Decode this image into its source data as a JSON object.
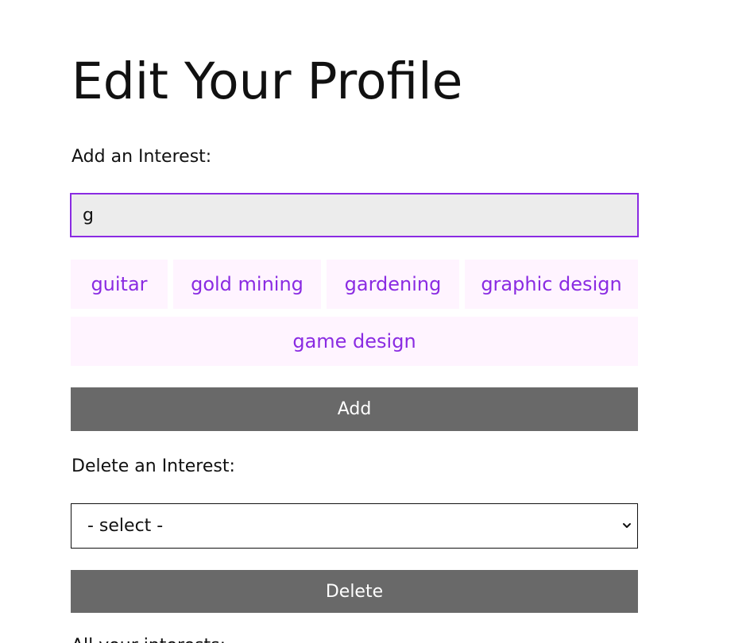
{
  "page": {
    "title": "Edit Your Profile"
  },
  "add_interest": {
    "label": "Add an Interest:",
    "input_value": "g",
    "suggestions": [
      "guitar",
      "gold mining",
      "gardening",
      "graphic design",
      "game design"
    ],
    "button_label": "Add"
  },
  "delete_interest": {
    "label": "Delete an Interest:",
    "select_value": "- select -",
    "button_label": "Delete"
  },
  "cutoff_text": "All your interests:",
  "icons": {
    "select_chevron": "chevron-down-icon"
  },
  "colors": {
    "accent": "#8a2be2",
    "suggestion_background": "#fff4ff",
    "button_background": "#696969",
    "input_background": "#ececec"
  }
}
